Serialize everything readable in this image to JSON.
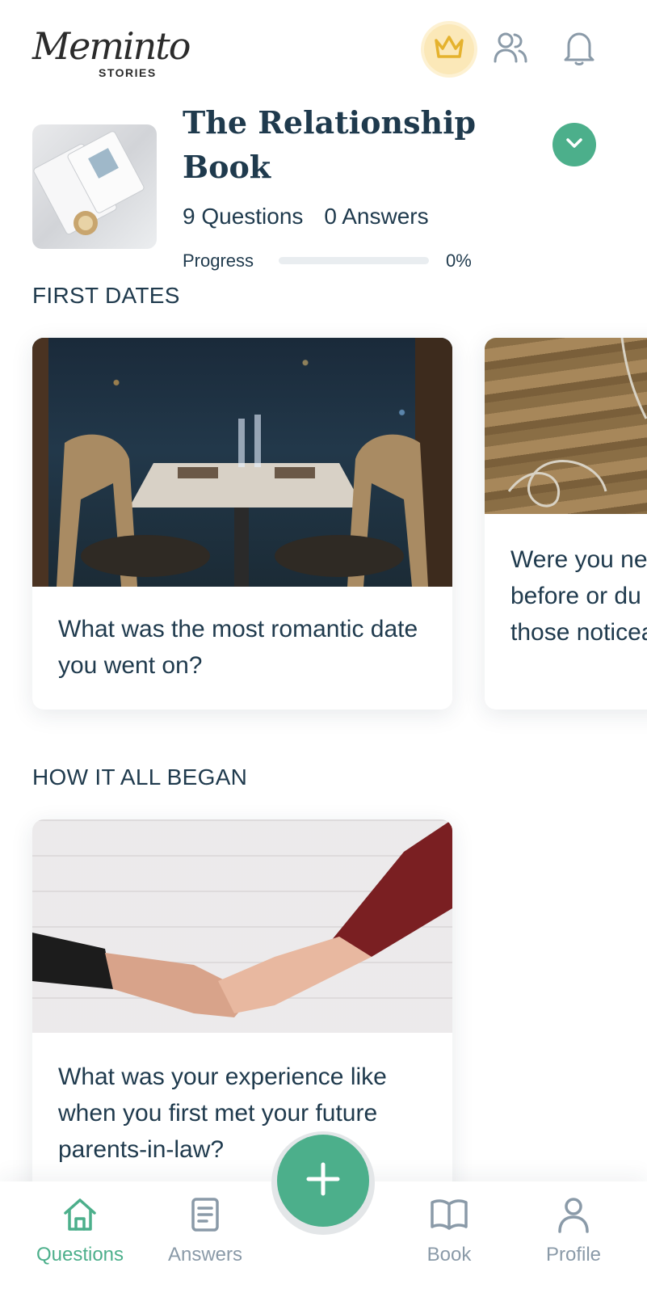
{
  "header": {
    "logo_script": "Meminto",
    "logo_sub": "STORIES",
    "icons": [
      "crown-icon",
      "users-icon",
      "bell-icon"
    ]
  },
  "book": {
    "title": "The Relationship Book",
    "questions_count": "9 Questions",
    "answers_count": "0 Answers",
    "progress_label": "Progress",
    "progress_percent": "0%",
    "progress_value": 0
  },
  "sections": [
    {
      "title": "FIRST DATES",
      "cards": [
        {
          "text": "What was the most romantic date you went on?"
        },
        {
          "text": "Were you ne before or du Were those noticeable?"
        }
      ]
    },
    {
      "title": "HOW IT ALL BEGAN",
      "cards": [
        {
          "text": "What was your experience like when you first met your future parents-in-law?"
        }
      ]
    }
  ],
  "bottom_nav": {
    "items": [
      {
        "label": "Questions",
        "icon": "home-icon",
        "active": true
      },
      {
        "label": "Answers",
        "icon": "document-icon",
        "active": false
      },
      {
        "label": "Book",
        "icon": "book-icon",
        "active": false
      },
      {
        "label": "Profile",
        "icon": "user-icon",
        "active": false
      }
    ],
    "fab_icon": "plus-icon"
  },
  "colors": {
    "accent": "#4caf8b",
    "text": "#1f3a4d",
    "muted": "#8a9aa8",
    "gold": "#e5b22d"
  }
}
